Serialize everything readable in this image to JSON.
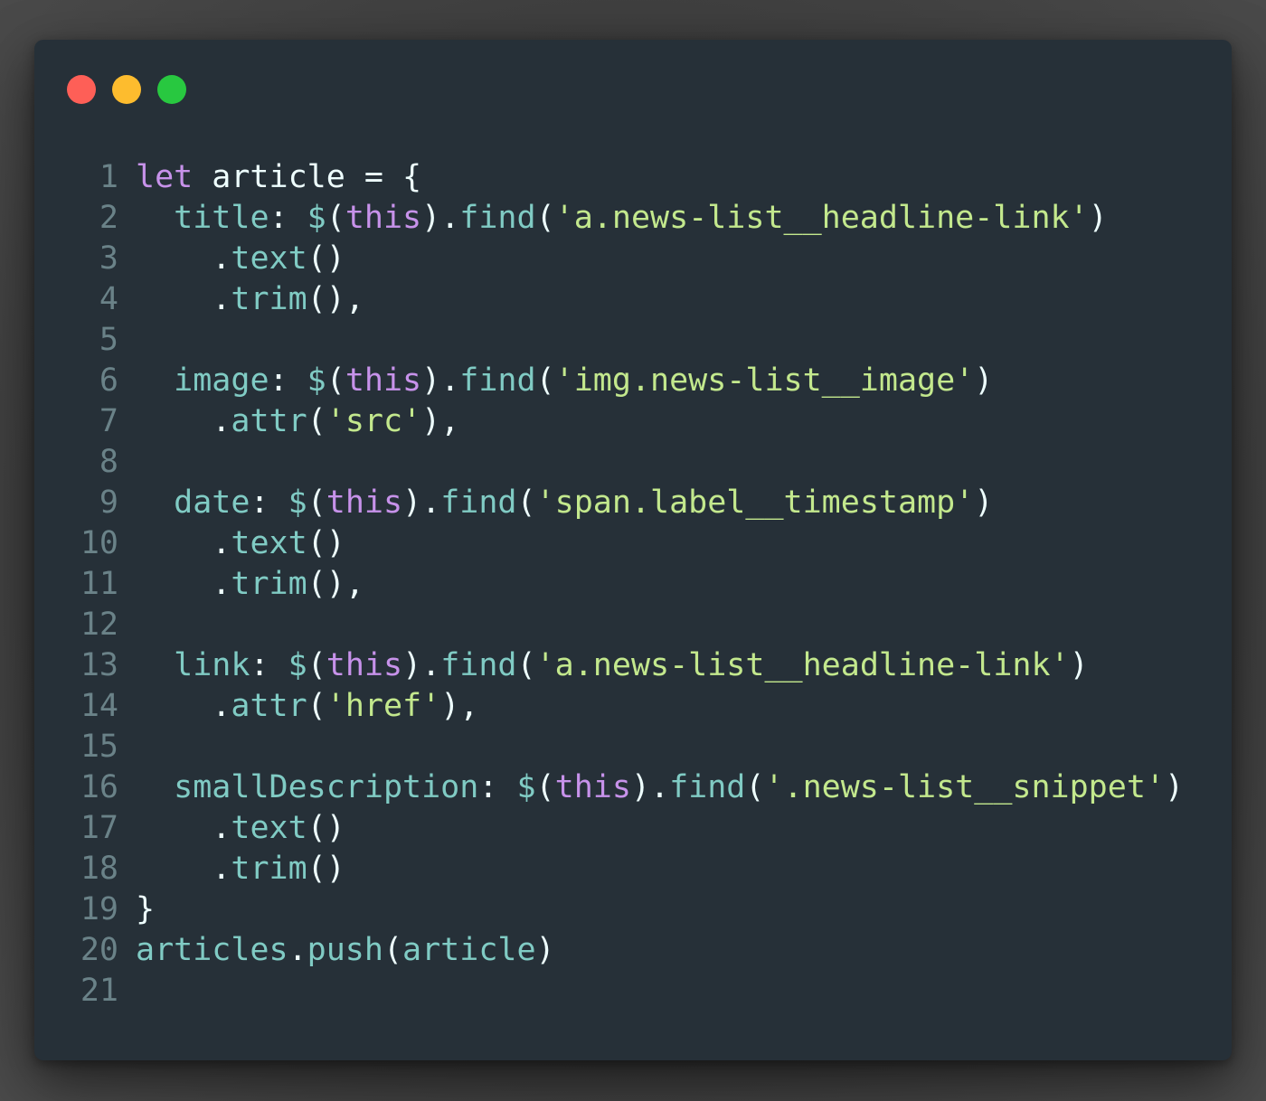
{
  "window": {
    "controls": [
      "close",
      "minimize",
      "zoom"
    ]
  },
  "code_lines": [
    {
      "n": "1",
      "tokens": [
        [
          "kw",
          "let"
        ],
        [
          "ident",
          " article "
        ],
        [
          "punc",
          "= {"
        ]
      ]
    },
    {
      "n": "2",
      "tokens": [
        [
          "ident",
          "  "
        ],
        [
          "prop",
          "title"
        ],
        [
          "punc",
          ": "
        ],
        [
          "dollar",
          "$"
        ],
        [
          "punc",
          "("
        ],
        [
          "kw",
          "this"
        ],
        [
          "punc",
          ")."
        ],
        [
          "fn",
          "find"
        ],
        [
          "punc",
          "("
        ],
        [
          "str",
          "'a.news-list__headline-link'"
        ],
        [
          "punc",
          ")"
        ]
      ]
    },
    {
      "n": "3",
      "tokens": [
        [
          "ident",
          "    "
        ],
        [
          "punc",
          "."
        ],
        [
          "fn",
          "text"
        ],
        [
          "punc",
          "()"
        ]
      ]
    },
    {
      "n": "4",
      "tokens": [
        [
          "ident",
          "    "
        ],
        [
          "punc",
          "."
        ],
        [
          "fn",
          "trim"
        ],
        [
          "punc",
          "(),"
        ]
      ]
    },
    {
      "n": "5",
      "tokens": []
    },
    {
      "n": "6",
      "tokens": [
        [
          "ident",
          "  "
        ],
        [
          "prop",
          "image"
        ],
        [
          "punc",
          ": "
        ],
        [
          "dollar",
          "$"
        ],
        [
          "punc",
          "("
        ],
        [
          "kw",
          "this"
        ],
        [
          "punc",
          ")."
        ],
        [
          "fn",
          "find"
        ],
        [
          "punc",
          "("
        ],
        [
          "str",
          "'img.news-list__image'"
        ],
        [
          "punc",
          ")"
        ]
      ]
    },
    {
      "n": "7",
      "tokens": [
        [
          "ident",
          "    "
        ],
        [
          "punc",
          "."
        ],
        [
          "fn",
          "attr"
        ],
        [
          "punc",
          "("
        ],
        [
          "str",
          "'src'"
        ],
        [
          "punc",
          "),"
        ]
      ]
    },
    {
      "n": "8",
      "tokens": []
    },
    {
      "n": "9",
      "tokens": [
        [
          "ident",
          "  "
        ],
        [
          "prop",
          "date"
        ],
        [
          "punc",
          ": "
        ],
        [
          "dollar",
          "$"
        ],
        [
          "punc",
          "("
        ],
        [
          "kw",
          "this"
        ],
        [
          "punc",
          ")."
        ],
        [
          "fn",
          "find"
        ],
        [
          "punc",
          "("
        ],
        [
          "str",
          "'span.label__timestamp'"
        ],
        [
          "punc",
          ")"
        ]
      ]
    },
    {
      "n": "10",
      "tokens": [
        [
          "ident",
          "    "
        ],
        [
          "punc",
          "."
        ],
        [
          "fn",
          "text"
        ],
        [
          "punc",
          "()"
        ]
      ]
    },
    {
      "n": "11",
      "tokens": [
        [
          "ident",
          "    "
        ],
        [
          "punc",
          "."
        ],
        [
          "fn",
          "trim"
        ],
        [
          "punc",
          "(),"
        ]
      ]
    },
    {
      "n": "12",
      "tokens": []
    },
    {
      "n": "13",
      "tokens": [
        [
          "ident",
          "  "
        ],
        [
          "prop",
          "link"
        ],
        [
          "punc",
          ": "
        ],
        [
          "dollar",
          "$"
        ],
        [
          "punc",
          "("
        ],
        [
          "kw",
          "this"
        ],
        [
          "punc",
          ")."
        ],
        [
          "fn",
          "find"
        ],
        [
          "punc",
          "("
        ],
        [
          "str",
          "'a.news-list__headline-link'"
        ],
        [
          "punc",
          ")"
        ]
      ]
    },
    {
      "n": "14",
      "tokens": [
        [
          "ident",
          "    "
        ],
        [
          "punc",
          "."
        ],
        [
          "fn",
          "attr"
        ],
        [
          "punc",
          "("
        ],
        [
          "str",
          "'href'"
        ],
        [
          "punc",
          "),"
        ]
      ]
    },
    {
      "n": "15",
      "tokens": []
    },
    {
      "n": "16",
      "tokens": [
        [
          "ident",
          "  "
        ],
        [
          "prop",
          "smallDescription"
        ],
        [
          "punc",
          ": "
        ],
        [
          "dollar",
          "$"
        ],
        [
          "punc",
          "("
        ],
        [
          "kw",
          "this"
        ],
        [
          "punc",
          ")."
        ],
        [
          "fn",
          "find"
        ],
        [
          "punc",
          "("
        ],
        [
          "str",
          "'.news-list__snippet'"
        ],
        [
          "punc",
          ")"
        ]
      ]
    },
    {
      "n": "17",
      "tokens": [
        [
          "ident",
          "    "
        ],
        [
          "punc",
          "."
        ],
        [
          "fn",
          "text"
        ],
        [
          "punc",
          "()"
        ]
      ]
    },
    {
      "n": "18",
      "tokens": [
        [
          "ident",
          "    "
        ],
        [
          "punc",
          "."
        ],
        [
          "fn",
          "trim"
        ],
        [
          "punc",
          "()"
        ]
      ]
    },
    {
      "n": "19",
      "tokens": [
        [
          "punc",
          "}"
        ]
      ]
    },
    {
      "n": "20",
      "tokens": [
        [
          "prop",
          "articles"
        ],
        [
          "punc",
          "."
        ],
        [
          "fn",
          "push"
        ],
        [
          "punc",
          "("
        ],
        [
          "prop",
          "article"
        ],
        [
          "punc",
          ")"
        ]
      ]
    },
    {
      "n": "21",
      "tokens": []
    }
  ],
  "colors": {
    "background": "#263038",
    "keyword": "#c792ea",
    "property": "#80cbc4",
    "string": "#c3e88d",
    "line_number": "#6a8288"
  }
}
